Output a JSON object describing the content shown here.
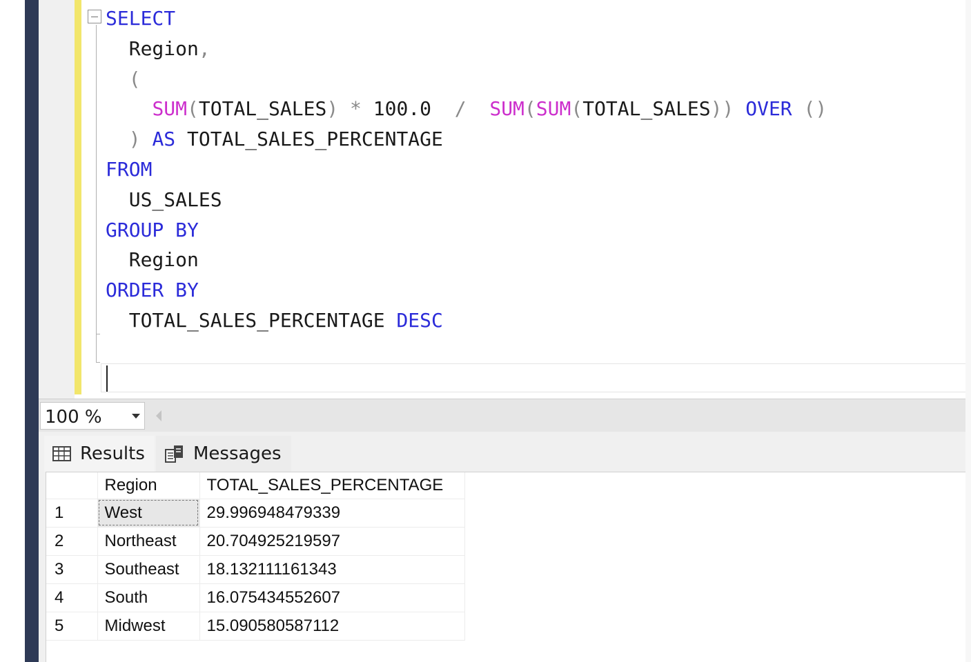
{
  "editor": {
    "lines": [
      [
        {
          "t": "SELECT",
          "c": "kw"
        }
      ],
      [
        {
          "t": "  Region",
          "c": ""
        },
        {
          "t": ",",
          "c": "gr"
        }
      ],
      [
        {
          "t": "  (",
          "c": "gr"
        }
      ],
      [
        {
          "t": "    ",
          "c": ""
        },
        {
          "t": "SUM",
          "c": "fn"
        },
        {
          "t": "(",
          "c": "gr"
        },
        {
          "t": "TOTAL_SALES",
          "c": ""
        },
        {
          "t": ") ",
          "c": "gr"
        },
        {
          "t": "* ",
          "c": "gr"
        },
        {
          "t": "100.0  ",
          "c": ""
        },
        {
          "t": "/  ",
          "c": "gr"
        },
        {
          "t": "SUM",
          "c": "fn"
        },
        {
          "t": "(",
          "c": "gr"
        },
        {
          "t": "SUM",
          "c": "fn"
        },
        {
          "t": "(",
          "c": "gr"
        },
        {
          "t": "TOTAL_SALES",
          "c": ""
        },
        {
          "t": ")) ",
          "c": "gr"
        },
        {
          "t": "OVER ",
          "c": "kw"
        },
        {
          "t": "()",
          "c": "gr"
        }
      ],
      [
        {
          "t": "  ) ",
          "c": "gr"
        },
        {
          "t": "AS ",
          "c": "kw"
        },
        {
          "t": "TOTAL_SALES_PERCENTAGE",
          "c": ""
        }
      ],
      [
        {
          "t": "FROM",
          "c": "kw"
        }
      ],
      [
        {
          "t": "  US_SALES",
          "c": ""
        }
      ],
      [
        {
          "t": "GROUP BY",
          "c": "kw"
        }
      ],
      [
        {
          "t": "  Region",
          "c": ""
        }
      ],
      [
        {
          "t": "ORDER BY",
          "c": "kw"
        }
      ],
      [
        {
          "t": "  TOTAL_SALES_PERCENTAGE ",
          "c": ""
        },
        {
          "t": "DESC",
          "c": "kw"
        }
      ]
    ]
  },
  "zoom": {
    "value": "100 %"
  },
  "tabs": {
    "results": "Results",
    "messages": "Messages"
  },
  "grid": {
    "columns": [
      "",
      "Region",
      "TOTAL_SALES_PERCENTAGE"
    ],
    "rows": [
      [
        "1",
        "West",
        "29.996948479339"
      ],
      [
        "2",
        "Northeast",
        "20.704925219597"
      ],
      [
        "3",
        "Southeast",
        "18.132111161343"
      ],
      [
        "4",
        "South",
        "16.075434552607"
      ],
      [
        "5",
        "Midwest",
        "15.090580587112"
      ]
    ]
  },
  "colors": {
    "keyword": "#2b2bd9",
    "function": "#cc2ecc",
    "operator": "#8a8a8a",
    "change_bar": "#f2e66b"
  }
}
